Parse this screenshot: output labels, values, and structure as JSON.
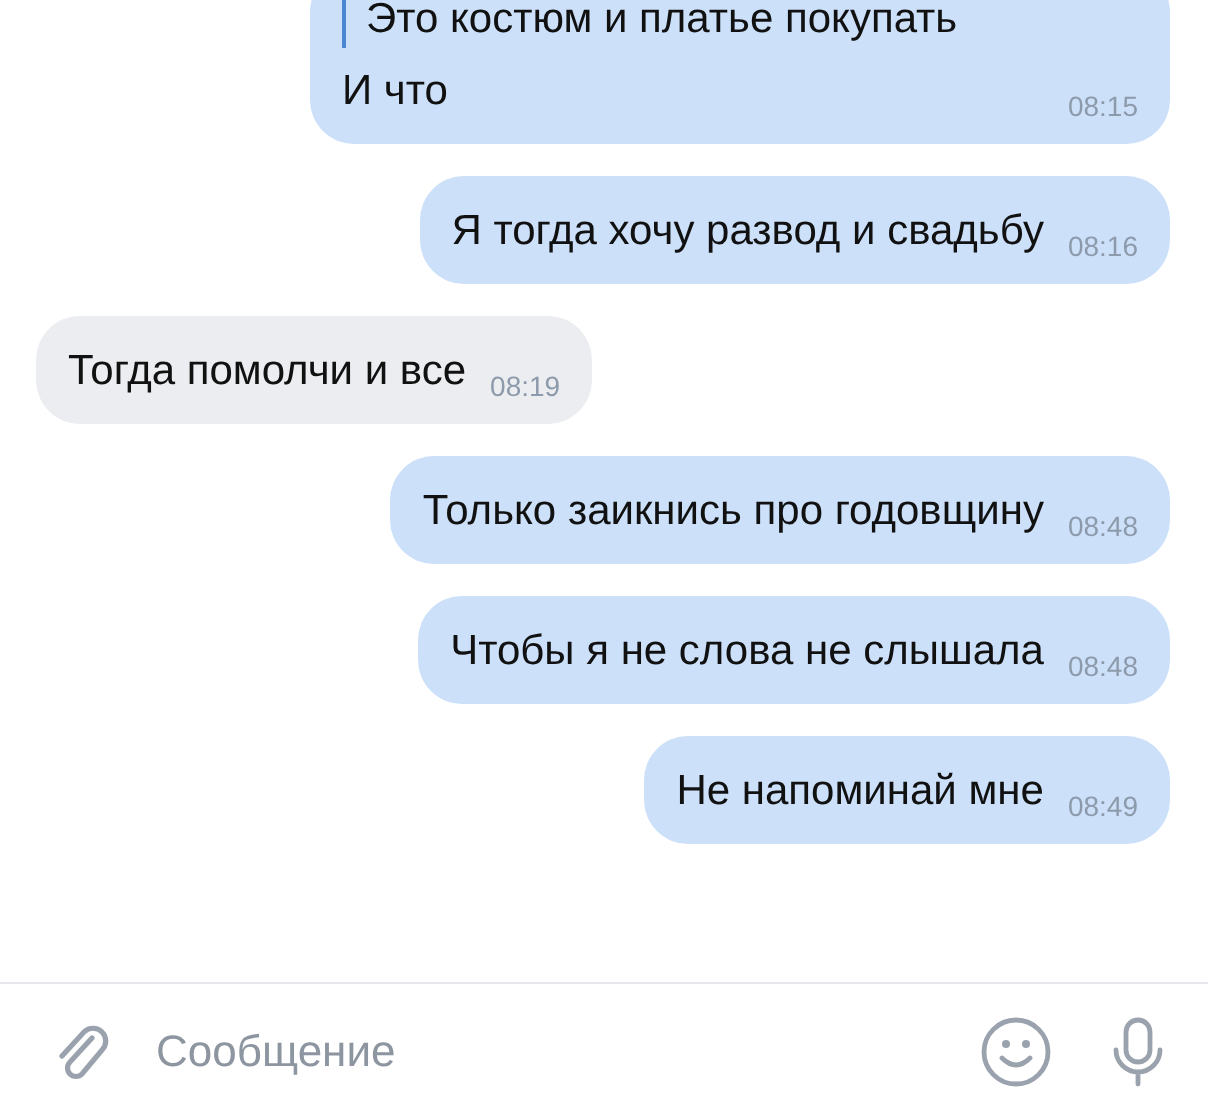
{
  "messages": [
    {
      "kind": "outgoing",
      "quote": "Это костюм и платье покупать",
      "text": "И что",
      "time": "08:15"
    },
    {
      "kind": "outgoing",
      "text": "Я тогда хочу развод и свадьбу",
      "time": "08:16"
    },
    {
      "kind": "incoming",
      "text": "Тогда помолчи и все",
      "time": "08:19"
    },
    {
      "kind": "outgoing",
      "text": "Только заикнись про годовщину",
      "time": "08:48"
    },
    {
      "kind": "outgoing",
      "text": "Чтобы я не слова не слышала",
      "time": "08:48"
    },
    {
      "kind": "outgoing",
      "text": "Не напоминай мне",
      "time": "08:49"
    }
  ],
  "composer": {
    "placeholder": "Сообщение"
  }
}
